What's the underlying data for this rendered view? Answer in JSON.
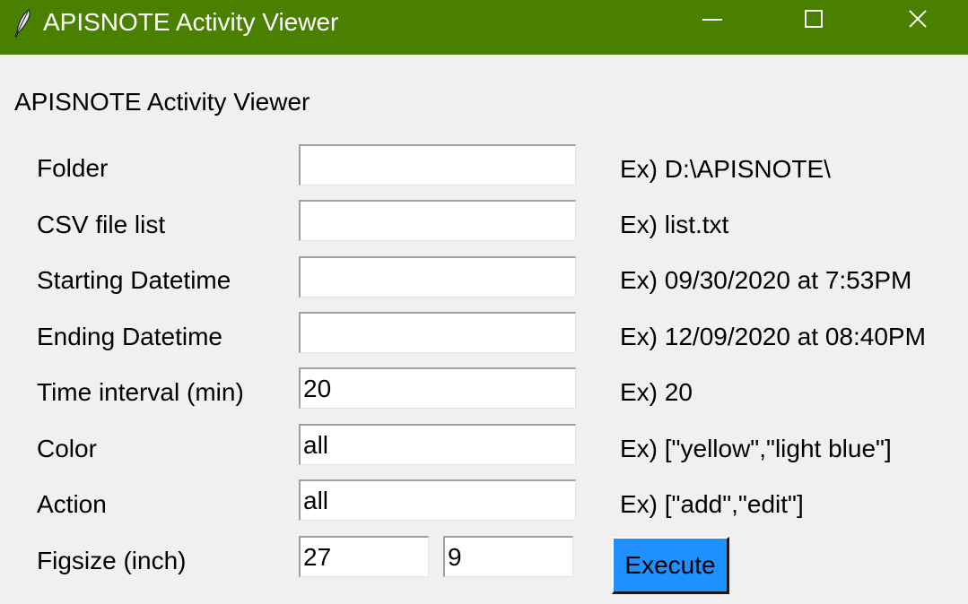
{
  "window": {
    "title": "APISNOTE Activity Viewer",
    "titlebar_color": "#4a8000",
    "app_icon": "feather-icon",
    "controls": [
      "minimize-icon",
      "maximize-icon",
      "close-icon"
    ]
  },
  "header": {
    "label": "APISNOTE Activity Viewer"
  },
  "form": {
    "folder": {
      "label": "Folder",
      "value": "",
      "example": "Ex) D:\\APISNOTE\\"
    },
    "csv_list": {
      "label": "CSV file list",
      "value": "",
      "example": "Ex) list.txt"
    },
    "start_dt": {
      "label": "Starting Datetime",
      "value": "",
      "example": "Ex) 09/30/2020 at 7:53PM"
    },
    "end_dt": {
      "label": "Ending Datetime",
      "value": "",
      "example": "Ex) 12/09/2020 at 08:40PM"
    },
    "interval": {
      "label": "Time interval (min)",
      "value": "20",
      "example": "Ex) 20"
    },
    "color": {
      "label": "Color",
      "value": "all",
      "example": "Ex) [\"yellow\",\"light blue\"]"
    },
    "action": {
      "label": "Action",
      "value": "all",
      "example": "Ex) [\"add\",\"edit\"]"
    },
    "figsize": {
      "label": "Figsize (inch)",
      "width": "27",
      "height": "9"
    }
  },
  "execute": {
    "label": "Execute",
    "color": "#1e90ff"
  }
}
